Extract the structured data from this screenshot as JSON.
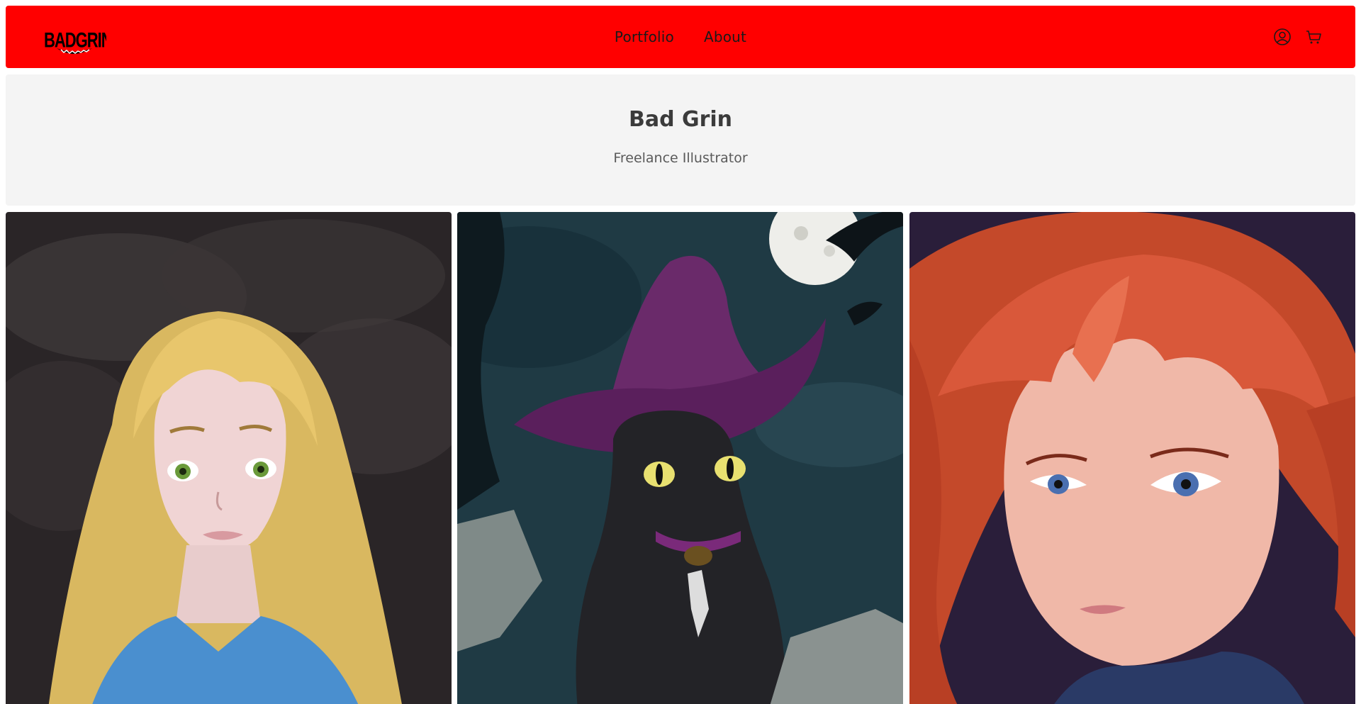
{
  "header": {
    "logo_text": "BADGRIN",
    "nav": [
      {
        "label": "Portfolio"
      },
      {
        "label": "About"
      }
    ],
    "icons": [
      "account-icon",
      "cart-icon"
    ],
    "background": "#ff0000"
  },
  "hero": {
    "title": "Bad Grin",
    "subtitle": "Freelance Illustrator"
  },
  "gallery": {
    "items": [
      {
        "name": "blonde-girl-artwork"
      },
      {
        "name": "witch-cat-artwork"
      },
      {
        "name": "redhead-girl-artwork"
      }
    ]
  },
  "colors": {
    "accent": "#ff0000",
    "hero_bg": "#f4f4f4"
  }
}
